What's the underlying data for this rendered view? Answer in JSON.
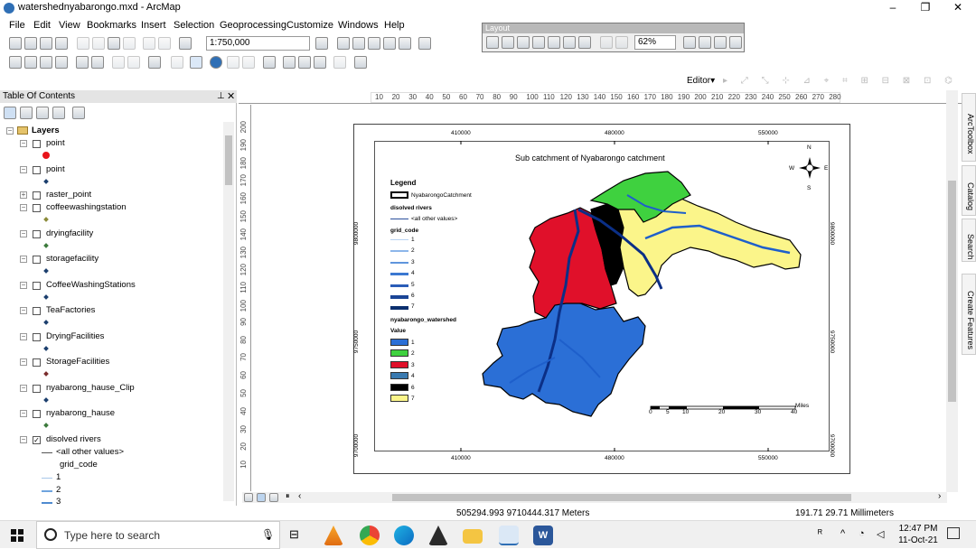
{
  "window": {
    "title": "watershednyabarongo.mxd - ArcMap"
  },
  "menu": [
    "File",
    "Edit",
    "View",
    "Bookmarks",
    "Insert",
    "Selection",
    "Geoprocessing",
    "Customize",
    "Windows",
    "Help"
  ],
  "toolbar": {
    "scale": "1:750,000",
    "layout_title": "Layout",
    "layout_zoom": "62%",
    "editor": "Editor▾"
  },
  "toc": {
    "title": "Table Of Contents",
    "root": "Layers",
    "layers": [
      {
        "name": "point",
        "symbol_color": "#e8141b"
      },
      {
        "name": "point"
      },
      {
        "name": "raster_point"
      },
      {
        "name": "coffeewashingstation",
        "symbol_color": "#8b8b3a"
      },
      {
        "name": "dryingfacility",
        "symbol_color": "#3c7a3c"
      },
      {
        "name": "storagefacility"
      },
      {
        "name": "CoffeeWashingStations"
      },
      {
        "name": "TeaFactories"
      },
      {
        "name": "DryingFacilities"
      },
      {
        "name": "StorageFacilities",
        "symbol_color": "#7a2c2c"
      },
      {
        "name": "nyabarong_hause_Clip"
      },
      {
        "name": "nyabarong_hause",
        "symbol_color": "#3c7a3c"
      },
      {
        "name": "disolved rivers"
      }
    ],
    "sublegend": [
      "<all other values>",
      "grid_code",
      "1",
      "2",
      "3"
    ]
  },
  "ruler_h": [
    "10",
    "20",
    "30",
    "40",
    "50",
    "60",
    "70",
    "80",
    "90",
    "100",
    "110",
    "120",
    "130",
    "140",
    "150",
    "160",
    "170",
    "180",
    "190",
    "200",
    "210",
    "220",
    "230",
    "240",
    "250",
    "260",
    "270",
    "280"
  ],
  "ruler_v": [
    "200",
    "190",
    "180",
    "170",
    "160",
    "150",
    "140",
    "130",
    "120",
    "110",
    "100",
    "90",
    "80",
    "70",
    "60",
    "50",
    "40",
    "30",
    "20",
    "10"
  ],
  "map": {
    "title": "Sub catchment of Nyabarongo catchment",
    "x_ticks": [
      "410000",
      "480000",
      "550000"
    ],
    "y_ticks_left": [
      "9800000",
      "9750000",
      "9700000"
    ],
    "y_ticks_right": [
      "9800000",
      "9750000",
      "9700000"
    ],
    "legend": {
      "title": "Legend",
      "catchment": "NyabarongoCatchment",
      "rivers": "disolved rivers",
      "rivers_other": "<all other values>",
      "grid_code": "grid_code",
      "grid_values": [
        "1",
        "2",
        "3",
        "4",
        "5",
        "6",
        "7"
      ],
      "watershed": "nyabarongo_watershed",
      "value": "Value",
      "watershed_values": [
        "1",
        "2",
        "3",
        "4",
        "6",
        "7"
      ],
      "watershed_colors": [
        "#2b6fd6",
        "#3fd13f",
        "#e0102a",
        "#3a7ab0",
        "#000000",
        "#fbf58a"
      ]
    },
    "scalebar": {
      "labels": [
        "0",
        "5",
        "10",
        "20",
        "30",
        "40"
      ],
      "unit": "Miles"
    },
    "north": {
      "n": "N",
      "s": "S",
      "e": "E",
      "w": "W"
    }
  },
  "status": {
    "coords": "505294.993  9710444.317 Meters",
    "page": "191.71  29.71 Millimeters"
  },
  "sidebar_tabs": [
    "ArcToolbox",
    "Catalog",
    "Search",
    "Create Features"
  ],
  "taskbar": {
    "search_placeholder": "Type here to search",
    "time": "12:47 PM",
    "date": "11-Oct-21"
  }
}
